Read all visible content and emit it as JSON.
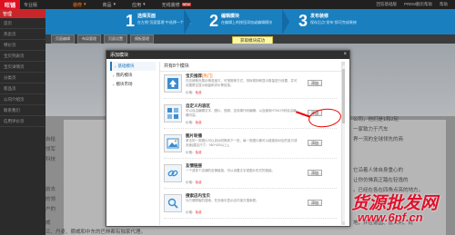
{
  "topbar": {
    "logo": "旺铺",
    "version": "专业版",
    "nav": [
      {
        "label": "装修",
        "active": true,
        "badge": ""
      },
      {
        "label": "商品",
        "active": false,
        "badge": ""
      },
      {
        "label": "应用",
        "active": false,
        "badge": ""
      },
      {
        "label": "无线装修",
        "active": false,
        "badge": "NEW"
      }
    ],
    "links": [
      "回答基础版",
      "PREM翻页帮助",
      "帮助"
    ]
  },
  "steps": [
    {
      "num": "1",
      "title": "选择页面",
      "desc": "在左侧\"页面管理\"中选择一个页面"
    },
    {
      "num": "2",
      "title": "编辑模块",
      "desc": "在编辑上的按钮添加或编辑模块"
    },
    {
      "num": "3",
      "title": "发布装修",
      "desc": "保存后点\"发布\"即可完成装修"
    }
  ],
  "sidebar": {
    "title": "管理",
    "items": [
      "首页",
      "热卖页",
      "特价页",
      "宝贝列表页",
      "宝贝详情页",
      "分类页",
      "新品页",
      "公司介绍页",
      "联系我们",
      "信用评价页"
    ]
  },
  "toolbar": {
    "buttons": [
      "页面编辑",
      "布局管理",
      "页面设置",
      "模板管理"
    ]
  },
  "toast": "获取模块成功",
  "preview": {
    "lines": [
      "自给",
      "领军",
      "科技",
      "前去",
      "的领",
      "户的",
      "威",
      "兰、丹麦、挪威和中东的巴林都有独家代理。",
      "公司，他们是1和2轮",
      "一家致力于汽车",
      "界一流的全球领先的商",
      "它沿着人体自身重心的",
      "让你仿佛真正踏在轻逸的",
      "。已经在各在四角点亮的地方，",
      "地，并在德国、意大利、荷"
    ]
  },
  "modal": {
    "title": "添加模块",
    "close": "×",
    "tabs": [
      {
        "label": "基础模块",
        "active": true
      },
      {
        "label": "我的模块",
        "active": false
      },
      {
        "label": "模块市场",
        "active": false
      }
    ],
    "list_title": "共有8个模块",
    "modules": [
      {
        "name": "宝贝推荐",
        "hot": "[热门]",
        "desc": "在店铺首页展示精选宝贝，可按推荐方式、排序规则和显示数量进行设置，并可设置是否显示销量和评价等信息。",
        "price": "价格：",
        "free": "免费",
        "button": "添加",
        "icon": "upload-icon"
      },
      {
        "name": "自定义内容区",
        "hot": "",
        "desc": "可以自由编辑文字、图片、视频、支持源代码编辑，以及使用HTML代码自由编辑内容。",
        "price": "价格：",
        "free": "免费",
        "button": "添加",
        "icon": "grid-icon"
      },
      {
        "name": "图片轮播",
        "hot": "",
        "desc": "单击的一张图片可以自动切换到下一张，每一张图片都可以链接到对应的宝贝或页面(建议尺寸：950*400以上)。",
        "price": "价格：",
        "free": "免费",
        "button": "添加",
        "icon": "image-icon"
      },
      {
        "name": "友情链接",
        "hot": "",
        "desc": "一个或多个店铺的友情链接，可以设置文字或图片形式的链接。",
        "price": "价格：",
        "free": "免费",
        "button": "添加",
        "icon": "link-icon"
      },
      {
        "name": "搜索店内宝贝",
        "hot": "",
        "desc": "为方便顾客的搜索，在页面中显示店内宝贝搜索框。",
        "price": "价格：",
        "free": "免费",
        "button": "添加",
        "icon": "search-icon"
      }
    ]
  },
  "watermark": {
    "line1": "货源批发网",
    "line2": "www.6pf.cn"
  },
  "colors": {
    "step_bar": "#1a7fbf",
    "sidebar_head": "#c8262a",
    "annotation": "#e00000",
    "watermark": "#e0112b"
  }
}
